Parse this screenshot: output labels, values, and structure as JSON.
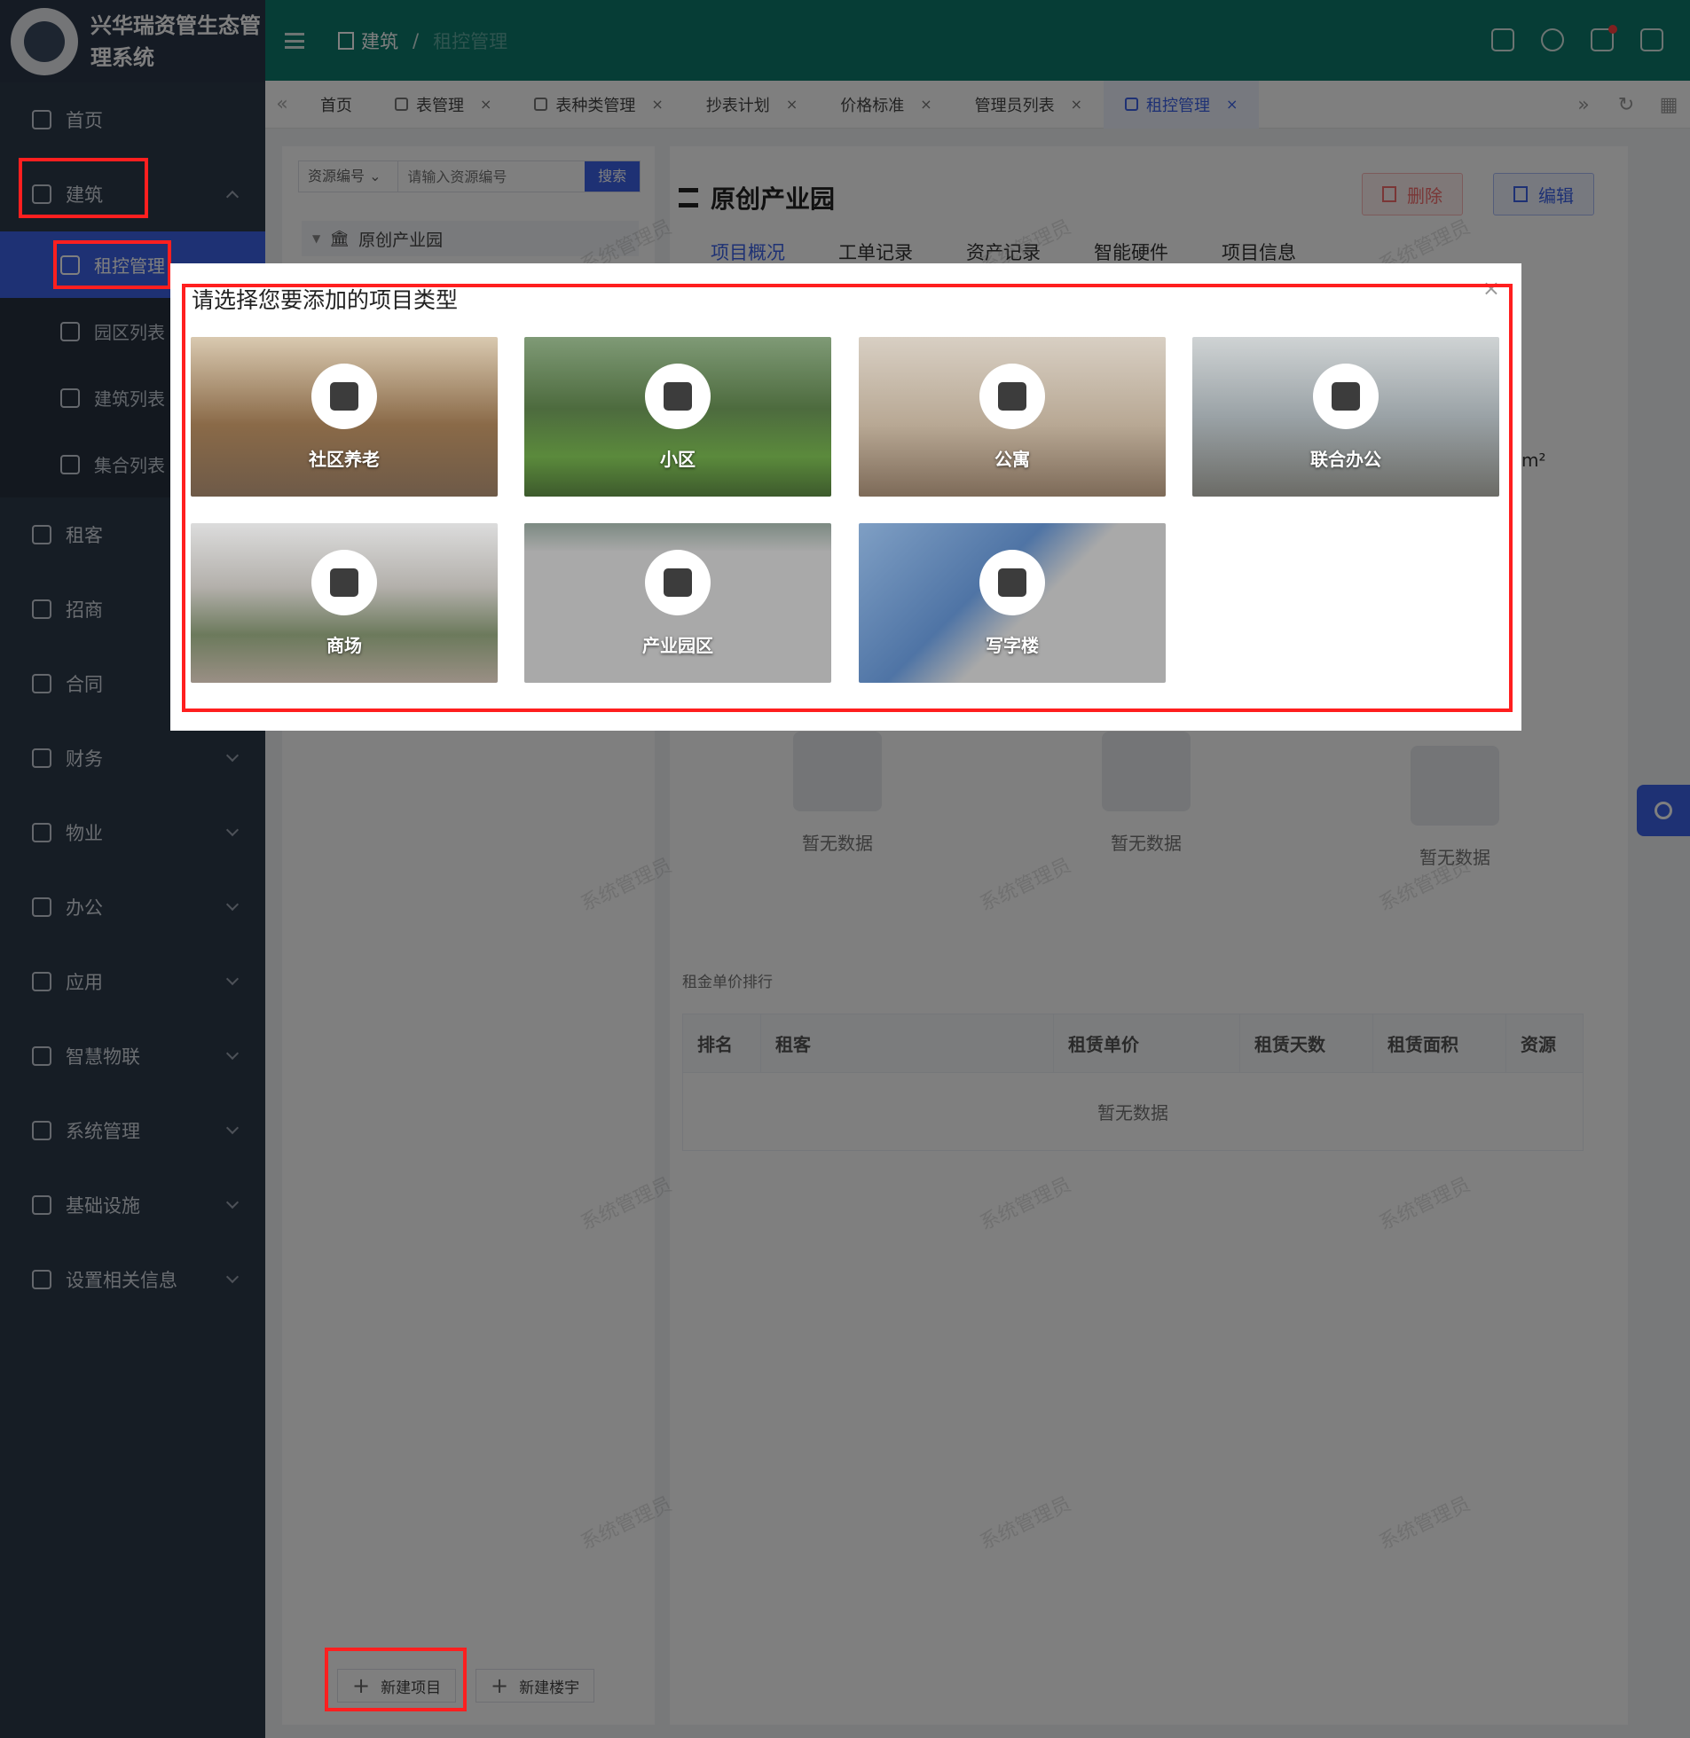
{
  "app": {
    "title": "兴华瑞资管生态管理系统"
  },
  "header": {
    "breadcrumb_root": "建筑",
    "breadcrumb_sep": "/",
    "breadcrumb_current": "租控管理"
  },
  "sidebar": {
    "items": [
      {
        "label": "首页",
        "icon": "home-icon"
      },
      {
        "label": "建筑",
        "icon": "building-icon",
        "expanded": true,
        "children": [
          {
            "label": "租控管理",
            "active": true
          },
          {
            "label": "园区列表"
          },
          {
            "label": "建筑列表"
          },
          {
            "label": "集合列表"
          }
        ]
      },
      {
        "label": "租客",
        "icon": "user-icon"
      },
      {
        "label": "招商",
        "icon": "briefcase-icon"
      },
      {
        "label": "合同",
        "icon": "document-icon"
      },
      {
        "label": "财务",
        "icon": "database-icon"
      },
      {
        "label": "物业",
        "icon": "building-icon"
      },
      {
        "label": "办公",
        "icon": "house-icon"
      },
      {
        "label": "应用",
        "icon": "app-icon"
      },
      {
        "label": "智慧物联",
        "icon": "monitor-icon"
      },
      {
        "label": "系统管理",
        "icon": "gear-icon"
      },
      {
        "label": "基础设施",
        "icon": "monitor-icon"
      },
      {
        "label": "设置相关信息",
        "icon": "aperture-icon"
      }
    ]
  },
  "tabs": [
    {
      "label": "首页",
      "closable": false
    },
    {
      "label": "表管理",
      "closable": true
    },
    {
      "label": "表种类管理",
      "closable": true
    },
    {
      "label": "抄表计划",
      "closable": true
    },
    {
      "label": "价格标准",
      "closable": true
    },
    {
      "label": "管理员列表",
      "closable": true
    },
    {
      "label": "租控管理",
      "closable": true,
      "active": true
    }
  ],
  "tab_close_glyph": "×",
  "tree": {
    "search_select": "资源编号",
    "search_placeholder": "请输入资源编号",
    "search_button": "搜索",
    "root_node": "原创产业园",
    "new_project_button": "新建项目",
    "new_building_button": "新建楼宇"
  },
  "content": {
    "title": "原创产业园",
    "delete_button": "删除",
    "edit_button": "编辑",
    "tabs": [
      "项目概况",
      "工单记录",
      "资产记录",
      "智能硬件",
      "项目信息"
    ],
    "area_unit_fragment": "m²",
    "empty_text": "暂无数据",
    "ranking": {
      "title": "租金单价排行",
      "columns": [
        "排名",
        "租客",
        "租赁单价",
        "租赁天数",
        "租赁面积",
        "资源"
      ],
      "empty_text": "暂无数据"
    },
    "watermark": "系统管理员"
  },
  "modal": {
    "title": "请选择您要添加的项目类型",
    "close_glyph": "×",
    "options": [
      {
        "label": "社区养老",
        "icon": "house-heart-icon"
      },
      {
        "label": "小区",
        "icon": "tree-building-icon"
      },
      {
        "label": "公寓",
        "icon": "apartment-icon"
      },
      {
        "label": "联合办公",
        "icon": "briefcase-icon"
      },
      {
        "label": "商场",
        "icon": "shopping-bag-icon"
      },
      {
        "label": "产业园区",
        "icon": "industrial-park-icon"
      },
      {
        "label": "写字楼",
        "icon": "office-tower-icon"
      }
    ]
  },
  "colors": {
    "sidebar_bg": "#2d3a4b",
    "header_bg": "#0d7a6c",
    "accent": "#3d63e8",
    "highlight_box": "#ff1f1f"
  }
}
